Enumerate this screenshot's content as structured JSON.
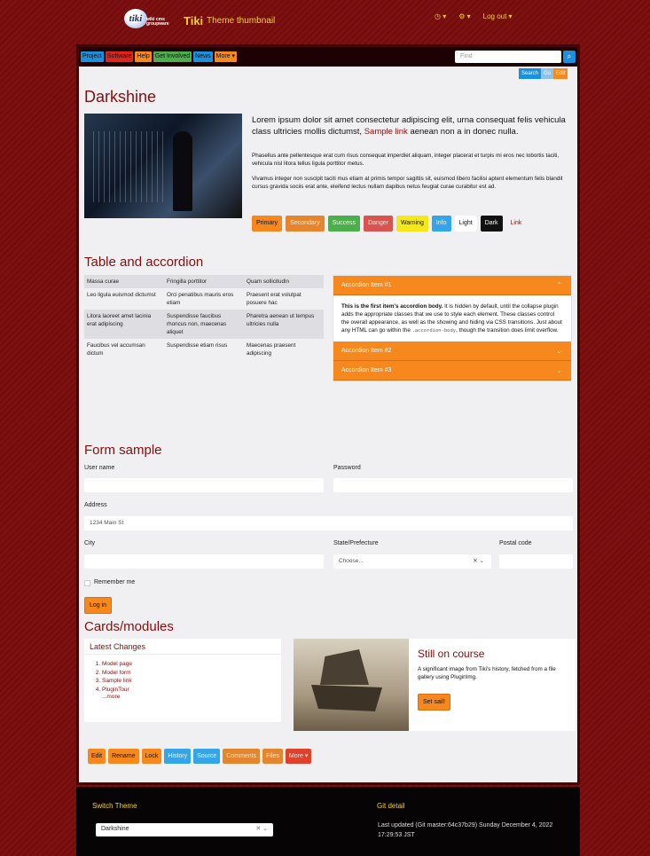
{
  "header": {
    "logo_text": "tiki",
    "logo_sub": "wiki cms groupware",
    "brand": "Tiki",
    "subtitle": "Theme thumbnail",
    "right": [
      {
        "icon": "clock-icon",
        "label": "◷ ▾"
      },
      {
        "icon": "gears-icon",
        "label": "⚙ ▾"
      },
      {
        "icon": "logout-icon",
        "label": "Log out ▾"
      }
    ]
  },
  "nav": {
    "items": [
      {
        "label": "Project",
        "color": "#1a90e0"
      },
      {
        "label": "Software",
        "color": "#e0241c"
      },
      {
        "label": "Help",
        "color": "#f7881e"
      },
      {
        "label": "Get Involved",
        "color": "#4cae4c"
      },
      {
        "label": "News",
        "color": "#1a90e0"
      },
      {
        "label": "More ▾",
        "color": "#f7881e"
      }
    ],
    "search_placeholder": "Find",
    "search_icon": "⌕",
    "tabs": [
      {
        "label": "Search",
        "color": "#1a90e0"
      },
      {
        "label": "Go",
        "color": "#8bc3ef"
      },
      {
        "label": "Edit",
        "color": "#f7881e"
      }
    ]
  },
  "content": {
    "title": "Darkshine",
    "lead_before": "Lorem ipsum dolor sit amet consectetur adipiscing elit, urna consequat felis vehicula class ultricies mollis dictumst,",
    "lead_link": "Sample link",
    "lead_after": "aenean non a in donec nulla.",
    "para1": "Phasellus ante pellentesque erat cum risus consequat imperdiet aliquam, integer placerat et turpis mi eros nec lobortis taciti, vehicula nisl litora tellus ligula porttitor metus.",
    "para2": "Vivamus integer non suscipit taciti mus etiam at primis tempor sagittis sit, euismod libero facilisi aptent elementum felis blandit cursus gravida sociis erat ante, eleifend lectus nullam dapibus netus feugiat curae curabitur est ad.",
    "buttons": [
      {
        "label": "Primary",
        "bg": "#f7881e",
        "fg": "#111"
      },
      {
        "label": "Secondary",
        "bg": "#e5862f",
        "fg": "#f7e2c7"
      },
      {
        "label": "Success",
        "bg": "#4cae4c",
        "fg": "#e8f7e8"
      },
      {
        "label": "Danger",
        "bg": "#d9534f",
        "fg": "#fbe3e3"
      },
      {
        "label": "Warning",
        "bg": "#f4e81a",
        "fg": "#111"
      },
      {
        "label": "Info",
        "bg": "#36a5e8",
        "fg": "#e6f4fd"
      },
      {
        "label": "Light",
        "bg": "#ffffff",
        "fg": "#111"
      },
      {
        "label": "Dark",
        "bg": "#111111",
        "fg": "#fff"
      },
      {
        "label": "Link",
        "bg": "transparent",
        "fg": "#8a0b0b"
      }
    ]
  },
  "table_section": {
    "heading": "Table and accordion",
    "rows": [
      [
        "Massa curae",
        "Fringilla porttitor",
        "Quam sollicitudin"
      ],
      [
        "Leo ligula euismod dictumst",
        "Orci penatibus mauris eros etiam",
        "Praesent erat volutpat posuere hac"
      ],
      [
        "Litora laoreet amet lacinia erat adipiscing",
        "Suspendisse faucibus rhoncus non, maecenas aliquet",
        "Pharetra aenean ut tempus ultricies nulla"
      ],
      [
        "Faucibus vel accumsan dictum",
        "Suspendisse etiam risus",
        "Maecenas praesent adipiscing"
      ]
    ],
    "accordion": [
      {
        "title": "Accordion Item #1",
        "chevron": "⌃"
      },
      {
        "title": "Accordion Item #2",
        "chevron": "⌄"
      },
      {
        "title": "Accordion Item #3",
        "chevron": "⌄"
      }
    ],
    "acc_body_bold": "This is the first item's accordion body.",
    "acc_body_text": "It is hidden by default, until the collapse plugin adds the appropriate classes that we use to style each element. These classes control the overall appearance, as well as the showing and hiding via CSS transitions. Just about any HTML can go within the",
    "acc_body_code": ".accordion-body",
    "acc_body_end": ", though the transition does limit overflow."
  },
  "form": {
    "heading": "Form sample",
    "username_label": "User name",
    "password_label": "Password",
    "address_label": "Address",
    "address_value": "1234 Main St",
    "city_label": "City",
    "state_label": "State/Prefecture",
    "state_value": "Choose...",
    "state_controls": "✕ ⌄",
    "postal_label": "Postal code",
    "remember_label": "Remember me",
    "login_label": "Log in"
  },
  "cards": {
    "heading": "Cards/modules",
    "latest_title": "Latest Changes",
    "latest_items": [
      "Model page",
      "Model form",
      "Sample link",
      "PluginTour"
    ],
    "latest_more": "...more",
    "course_title": "Still on course",
    "course_text": "A significant image from Tiki's history, fetched from a file gallery using PluginImg.",
    "course_button": "Set sail!"
  },
  "actions": [
    {
      "label": "Edit",
      "bg": "#f7881e",
      "fg": "#111"
    },
    {
      "label": "Rename",
      "bg": "#f7881e",
      "fg": "#111"
    },
    {
      "label": "Lock",
      "bg": "#f7881e",
      "fg": "#111"
    },
    {
      "label": "History",
      "bg": "#36a5e8",
      "fg": "#e6f4fd"
    },
    {
      "label": "Source",
      "bg": "#36a5e8",
      "fg": "#e6f4fd"
    },
    {
      "label": "Comments",
      "bg": "#e5862f",
      "fg": "#f7e2c7"
    },
    {
      "label": "Files",
      "bg": "#e5862f",
      "fg": "#f7e2c7"
    },
    {
      "label": "More ▾",
      "bg": "#e0412b",
      "fg": "#fbe3e3"
    }
  ],
  "footer": {
    "switch_title": "Switch Theme",
    "theme_value": "Darkshine",
    "theme_controls": "✕ ⌄",
    "git_title": "Git detail",
    "git_text": "Last updated (Git master:64c37b29) Sunday December 4, 2022 17:29:53 JST"
  }
}
